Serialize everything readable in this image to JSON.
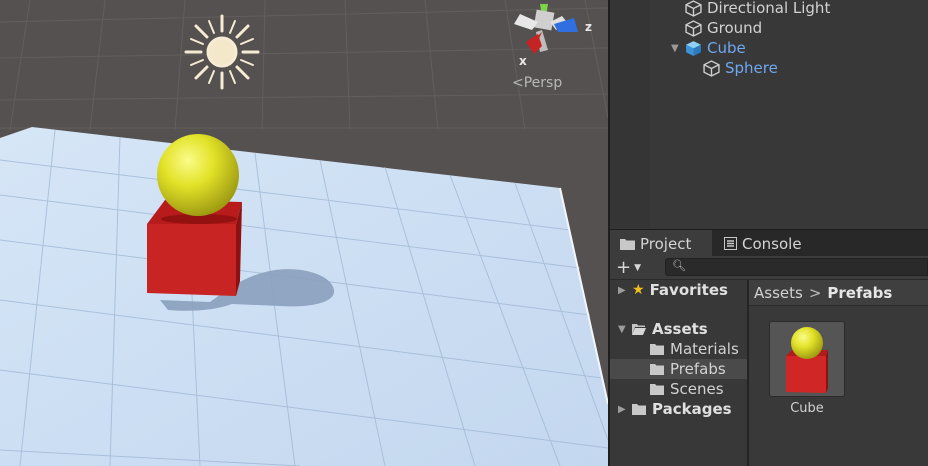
{
  "scene": {
    "persp_label": "Persp",
    "gizmo_axes": {
      "x": "x",
      "z": "z"
    }
  },
  "hierarchy": {
    "items": [
      {
        "label": "Directional Light",
        "icon": "gameobject-cube-icon",
        "highlight": false
      },
      {
        "label": "Ground",
        "icon": "gameobject-cube-icon",
        "highlight": false
      },
      {
        "label": "Cube",
        "icon": "prefab-cube-icon",
        "highlight": true,
        "expanded": true
      },
      {
        "label": "Sphere",
        "icon": "gameobject-cube-icon",
        "highlight": true
      }
    ]
  },
  "project": {
    "tabs": [
      {
        "label": "Project",
        "icon": "folder-icon",
        "active": true
      },
      {
        "label": "Console",
        "icon": "console-icon",
        "active": false
      }
    ],
    "add_button": "+",
    "search": {
      "value": "",
      "placeholder": ""
    },
    "tree": {
      "favorites": "Favorites",
      "assets": "Assets",
      "asset_folders": [
        "Materials",
        "Prefabs",
        "Scenes"
      ],
      "selected_folder": "Prefabs",
      "packages": "Packages"
    },
    "breadcrumb": {
      "root": "Assets",
      "current": "Prefabs"
    },
    "assets": [
      {
        "name": "Cube",
        "icon": "prefab-preview"
      }
    ]
  },
  "colors": {
    "highlight_text": "#6fa8ef",
    "cube_red": "#c72222",
    "sphere_yellow": "#e0e020",
    "ground": "#c9dcf2"
  }
}
